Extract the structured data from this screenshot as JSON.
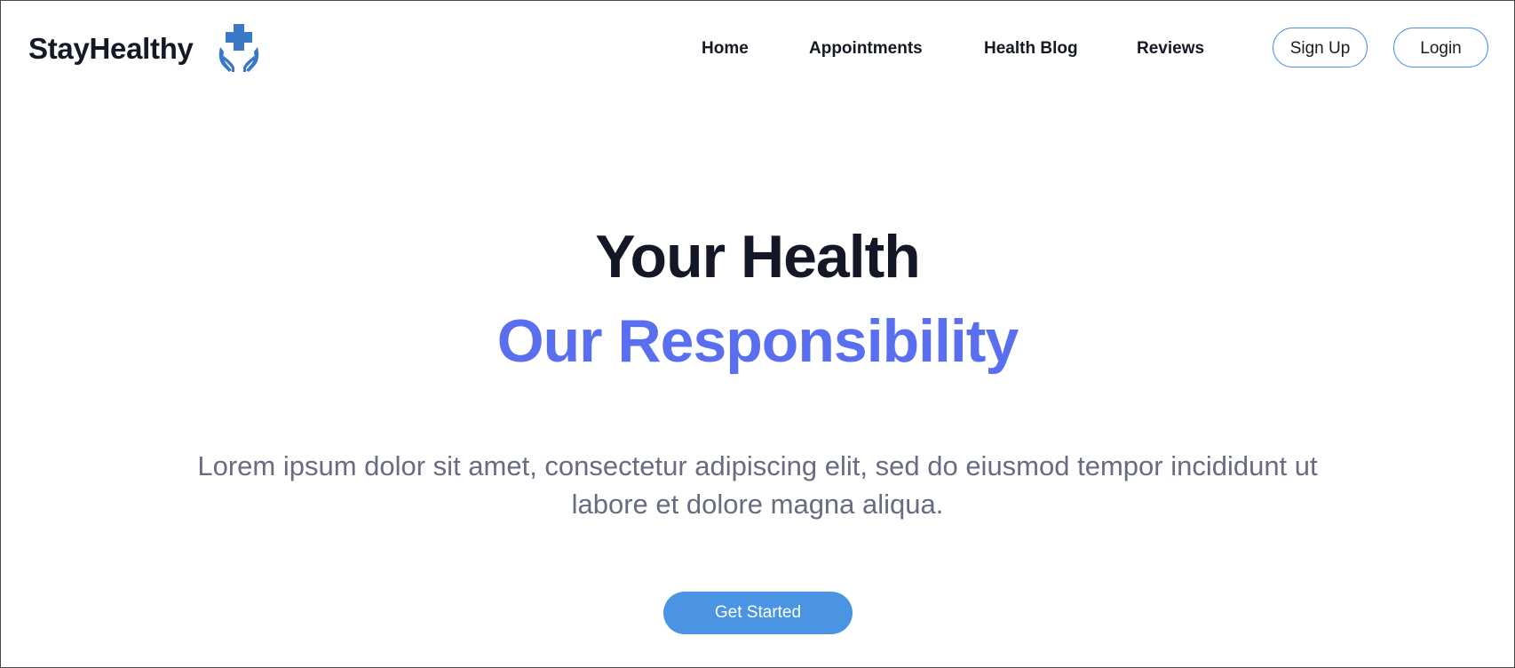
{
  "brand": {
    "name": "StayHealthy",
    "logo_icon": "medical-hands-cross-icon",
    "logo_color": "#3b79c7"
  },
  "nav": {
    "links": [
      {
        "label": "Home"
      },
      {
        "label": "Appointments"
      },
      {
        "label": "Health Blog"
      },
      {
        "label": "Reviews"
      }
    ],
    "signup_label": "Sign Up",
    "login_label": "Login"
  },
  "hero": {
    "title_line1": "Your Health",
    "title_line2": "Our Responsibility",
    "description": "Lorem ipsum dolor sit amet, consectetur adipiscing elit, sed do eiusmod  tempor incididunt ut labore et dolore magna aliqua.",
    "cta_label": "Get Started"
  },
  "colors": {
    "accent": "#5a6ff0",
    "button": "#4a94e3",
    "text_dark": "#141725",
    "text_muted": "#686c82"
  }
}
